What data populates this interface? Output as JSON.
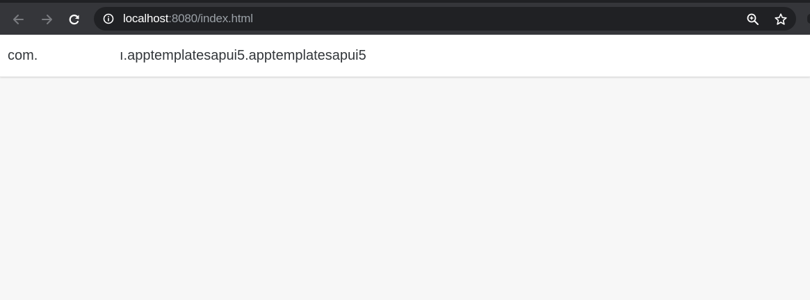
{
  "browser": {
    "url_host": "localhost",
    "url_rest": ":8080/index.html",
    "icons": {
      "back": "back-arrow-icon",
      "forward": "forward-arrow-icon",
      "reload": "reload-icon",
      "info": "info-icon",
      "zoom": "zoom-icon",
      "bookmark": "star-icon"
    },
    "colors": {
      "chrome": "#35363a",
      "omnibox": "#202124",
      "host_text": "#ffffff",
      "path_text": "#9aa0a6"
    }
  },
  "app": {
    "title_left": "com.",
    "title_right": "ı.apptemplatesapui5.apptemplatesapui5",
    "colors": {
      "header_bg": "#ffffff",
      "content_bg": "#f7f7f7",
      "title_text": "#32363a"
    }
  }
}
